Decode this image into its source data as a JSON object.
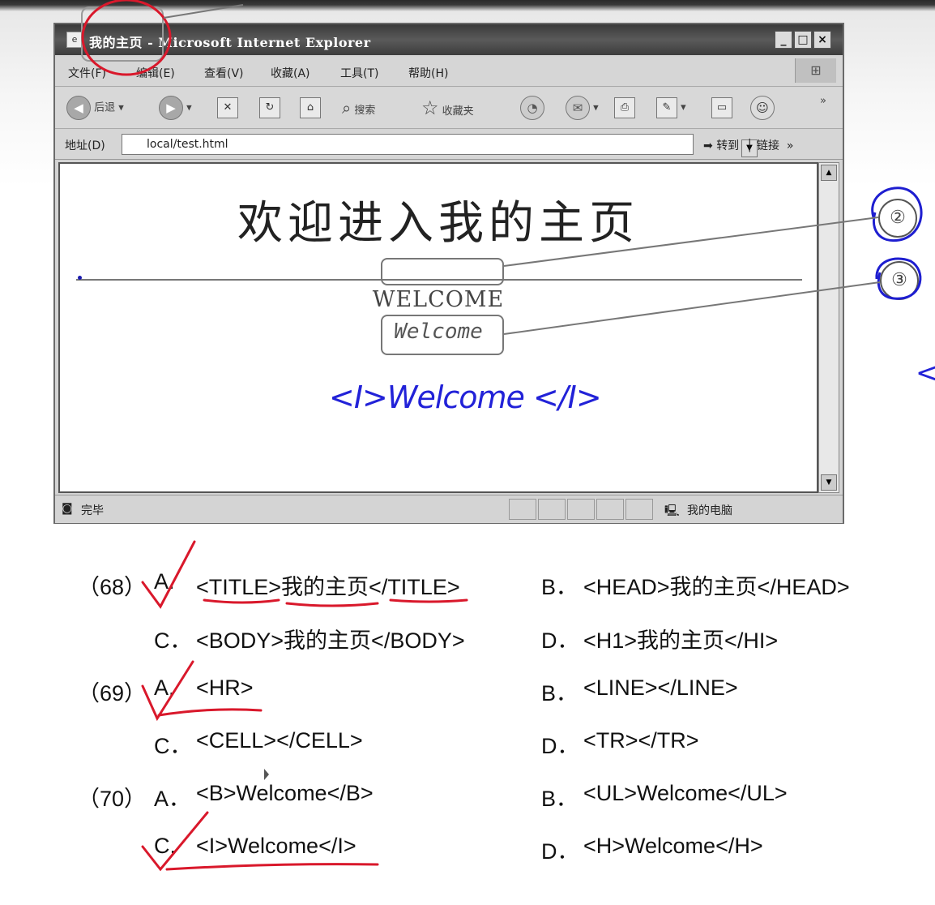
{
  "window": {
    "title": "我的主页 - Microsoft Internet Explorer",
    "icon": "ie-page-icon",
    "controls": {
      "minimize": "_",
      "maximize": "□",
      "close": "×"
    }
  },
  "menu": [
    "文件(F)",
    "编辑(E)",
    "查看(V)",
    "收藏(A)",
    "工具(T)",
    "帮助(H)"
  ],
  "toolbar": {
    "back": "后退",
    "search": "搜索",
    "favorites": "收藏夹",
    "more": "»"
  },
  "address": {
    "label": "地址(D)",
    "value": "local/test.html",
    "go": "转到",
    "links": "链接",
    "more": "»"
  },
  "page": {
    "heading": "欢迎进入我的主页",
    "welcome_plain": "WELCOME",
    "welcome_italic": "Welcome",
    "handwritten_note": "<I>Welcome </I>"
  },
  "status": {
    "left": "完毕",
    "right": "我的电脑"
  },
  "callouts": [
    "②",
    "③"
  ],
  "side_mark": "<",
  "questions": [
    {
      "num": "（68）",
      "options": [
        {
          "key": "A.",
          "text": "<TITLE>我的主页</TITLE>",
          "checked": true
        },
        {
          "key": "B．",
          "text": "<HEAD>我的主页</HEAD>",
          "checked": false
        },
        {
          "key": "C．",
          "text": "<BODY>我的主页</BODY>",
          "checked": false
        },
        {
          "key": "D．",
          "text": "<H1>我的主页</HI>",
          "checked": false
        }
      ]
    },
    {
      "num": "（69）",
      "options": [
        {
          "key": "A.",
          "text": "<HR>",
          "checked": true
        },
        {
          "key": "B．",
          "text": "<LINE></LINE>",
          "checked": false
        },
        {
          "key": "C．",
          "text": "<CELL></CELL>",
          "checked": false
        },
        {
          "key": "D．",
          "text": "<TR></TR>",
          "checked": false
        }
      ]
    },
    {
      "num": "（70）",
      "options": [
        {
          "key": "A．",
          "text": "<B>Welcome</B>",
          "checked": false
        },
        {
          "key": "B．",
          "text": "<UL>Welcome</UL>",
          "checked": false
        },
        {
          "key": "C.",
          "text": "<I>Welcome</I>",
          "checked": true
        },
        {
          "key": "D．",
          "text": "<H>Welcome</H>",
          "checked": false
        }
      ]
    }
  ],
  "colors": {
    "annotation_red": "#d9182b",
    "annotation_blue": "#2222d8"
  }
}
